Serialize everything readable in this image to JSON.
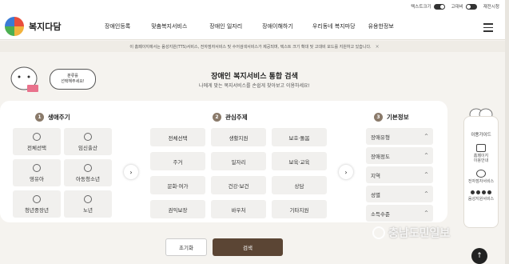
{
  "topbar": {
    "text_size_label": "텍스트크기",
    "high_contrast_label": "고대비",
    "reset_label": "재전시청"
  },
  "header": {
    "logo_text": "복지다담",
    "nav": [
      "장애인등록",
      "맞춤복지서비스",
      "장애인 일자리",
      "장애이해하기",
      "우리동네 복지마당",
      "유용한정보"
    ]
  },
  "notice": {
    "text": "이 홈페이지에서는 음성지원(TTS)서비스, 전자점자서비스 및 수어검색서비스가 제공되며, 텍스트 크기 확대 및 고대비 모드를 지원하고 있습니다."
  },
  "hero": {
    "bubble_line1": "분류를",
    "bubble_line2": "선택해주세요!",
    "title": "장애인 복지서비스 통합 검색",
    "subtitle": "나에게 맞는 복지서비스를 손쉽게 찾아보고 이용하세요!"
  },
  "lifecycle": {
    "num": "1",
    "heading": "생애주기",
    "items": [
      "전체선택",
      "임신출산",
      "영유아",
      "아동청소년",
      "청년중장년",
      "노년"
    ]
  },
  "interest": {
    "num": "2",
    "heading": "관심주제",
    "items": [
      "전체선택",
      "생활지원",
      "보호·돌봄",
      "주거",
      "일자리",
      "보육·교육",
      "문화·여가",
      "건강·보건",
      "상담",
      "권익보장",
      "바우처",
      "기타지원"
    ]
  },
  "basic": {
    "num": "3",
    "heading": "기본정보",
    "items": [
      "장애유형",
      "장애정도",
      "지역",
      "성별",
      "소득수준"
    ]
  },
  "actions": {
    "reset": "초기화",
    "search": "검색"
  },
  "guide": {
    "title": "이용가이드",
    "item1_line1": "홈페이지",
    "item1_line2": "이용안내",
    "item2": "전자점자서비스",
    "item3": "음성지원서비스"
  },
  "watermark": "충남도민일보",
  "colors": {
    "brown_button": "#5b4534",
    "page_bg": "#f5f3ef",
    "chip_bg": "#f1f0ee"
  },
  "icons": {
    "next": "›",
    "chevron": "^",
    "top": "↑",
    "close": "×"
  }
}
